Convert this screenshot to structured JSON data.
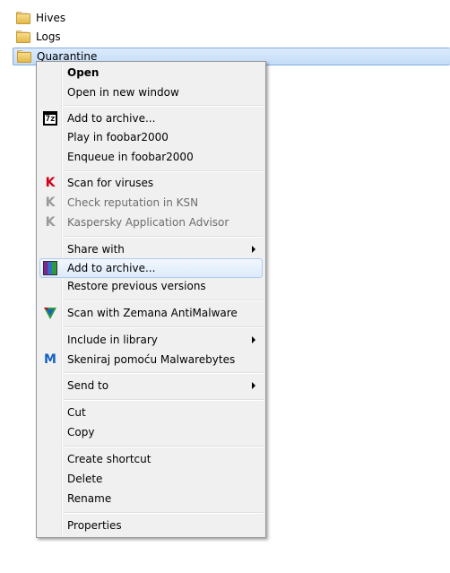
{
  "explorer": {
    "files": [
      {
        "name": "Hives"
      },
      {
        "name": "Logs"
      },
      {
        "name": "Quarantine"
      }
    ]
  },
  "context_menu": {
    "open": "Open",
    "open_new_window": "Open in new window",
    "add_to_archive_7z": "Add to archive...",
    "play_foobar": "Play in foobar2000",
    "enqueue_foobar": "Enqueue in foobar2000",
    "scan_viruses": "Scan for viruses",
    "check_ksn": "Check reputation in KSN",
    "kaspersky_advisor": "Kaspersky Application Advisor",
    "share_with": "Share with",
    "add_to_archive_rar": "Add to archive...",
    "restore_previous": "Restore previous versions",
    "scan_zemana": "Scan with Zemana AntiMalware",
    "include_library": "Include in library",
    "scan_malwarebytes": "Skeniraj pomoću Malwarebytes",
    "send_to": "Send to",
    "cut": "Cut",
    "copy": "Copy",
    "create_shortcut": "Create shortcut",
    "delete": "Delete",
    "rename": "Rename",
    "properties": "Properties"
  },
  "icons": {
    "sevenzip_glyph": "7z",
    "kaspersky_glyph": "K",
    "malwarebytes_glyph": "M"
  },
  "colors": {
    "selection_border": "#84acdd",
    "hover_border": "#aeccf1",
    "kaspersky_red": "#d1001c",
    "disabled_text": "#6d6d6d"
  }
}
